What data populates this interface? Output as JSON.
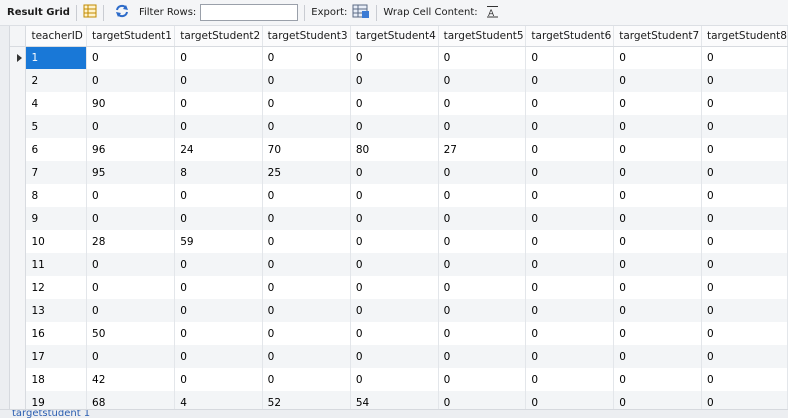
{
  "toolbar": {
    "result_grid_label": "Result Grid",
    "filter_rows_label": "Filter Rows:",
    "filter_value": "",
    "export_label": "Export:",
    "wrap_label": "Wrap Cell Content:"
  },
  "icons": {
    "grid": "grid-icon",
    "refresh": "refresh-icon",
    "export": "export-icon",
    "wrap": "wrap-text-icon"
  },
  "columns": [
    "teacherID",
    "targetStudent1",
    "targetStudent2",
    "targetStudent3",
    "targetStudent4",
    "targetStudent5",
    "targetStudent6",
    "targetStudent7",
    "targetStudent8"
  ],
  "rows": [
    [
      "1",
      "0",
      "0",
      "0",
      "0",
      "0",
      "0",
      "0",
      "0"
    ],
    [
      "2",
      "0",
      "0",
      "0",
      "0",
      "0",
      "0",
      "0",
      "0"
    ],
    [
      "4",
      "90",
      "0",
      "0",
      "0",
      "0",
      "0",
      "0",
      "0"
    ],
    [
      "5",
      "0",
      "0",
      "0",
      "0",
      "0",
      "0",
      "0",
      "0"
    ],
    [
      "6",
      "96",
      "24",
      "70",
      "80",
      "27",
      "0",
      "0",
      "0"
    ],
    [
      "7",
      "95",
      "8",
      "25",
      "0",
      "0",
      "0",
      "0",
      "0"
    ],
    [
      "8",
      "0",
      "0",
      "0",
      "0",
      "0",
      "0",
      "0",
      "0"
    ],
    [
      "9",
      "0",
      "0",
      "0",
      "0",
      "0",
      "0",
      "0",
      "0"
    ],
    [
      "10",
      "28",
      "59",
      "0",
      "0",
      "0",
      "0",
      "0",
      "0"
    ],
    [
      "11",
      "0",
      "0",
      "0",
      "0",
      "0",
      "0",
      "0",
      "0"
    ],
    [
      "12",
      "0",
      "0",
      "0",
      "0",
      "0",
      "0",
      "0",
      "0"
    ],
    [
      "13",
      "0",
      "0",
      "0",
      "0",
      "0",
      "0",
      "0",
      "0"
    ],
    [
      "16",
      "50",
      "0",
      "0",
      "0",
      "0",
      "0",
      "0",
      "0"
    ],
    [
      "17",
      "0",
      "0",
      "0",
      "0",
      "0",
      "0",
      "0",
      "0"
    ],
    [
      "18",
      "42",
      "0",
      "0",
      "0",
      "0",
      "0",
      "0",
      "0"
    ],
    [
      "19",
      "68",
      "4",
      "52",
      "54",
      "0",
      "0",
      "0",
      "0"
    ]
  ],
  "selected_cell": {
    "row": 0,
    "col": 0
  },
  "bottom_tab": {
    "label": "targetstudent 1"
  },
  "colors": {
    "selection": "#1978d7"
  }
}
